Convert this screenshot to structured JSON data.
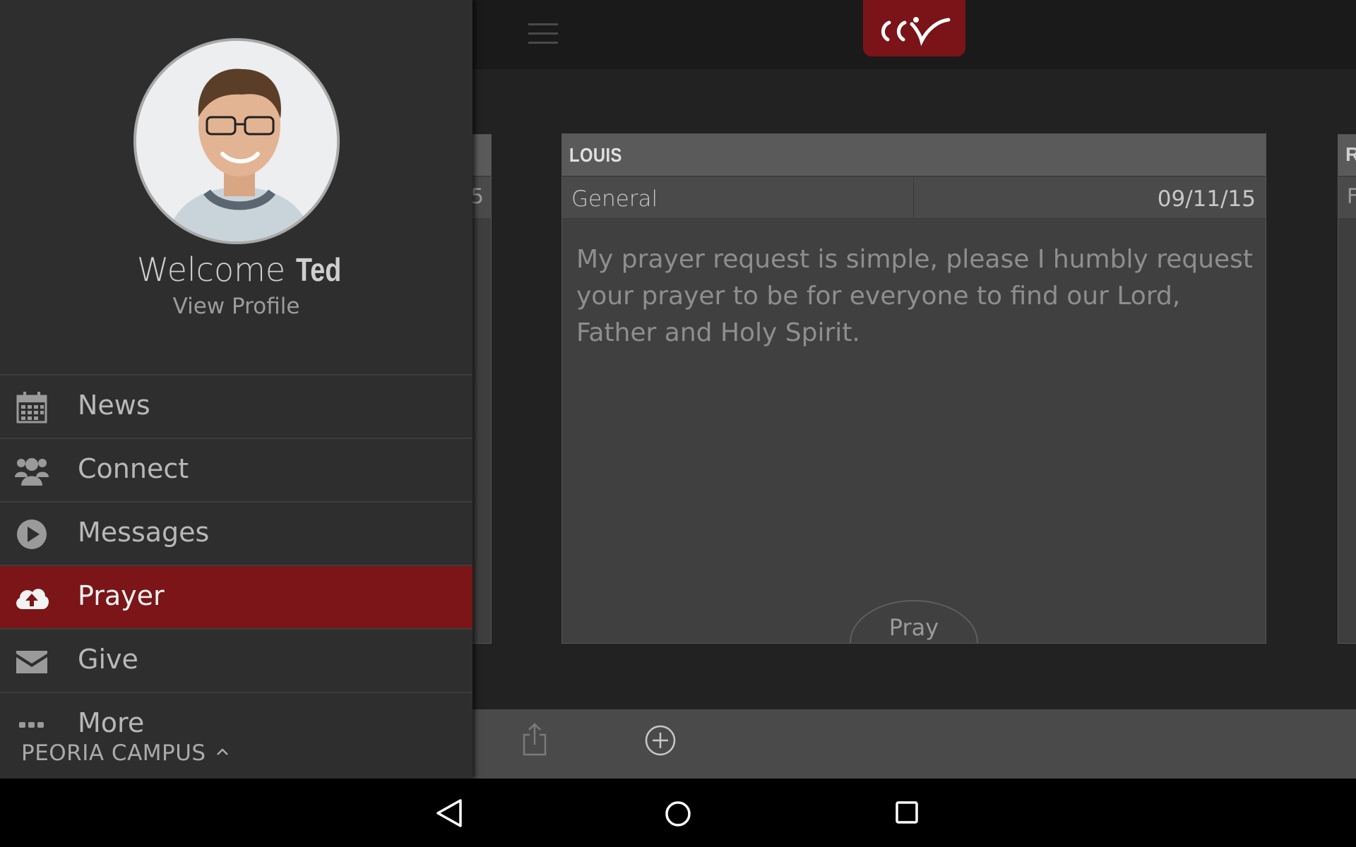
{
  "header": {
    "logo_icon": "ccv-logo"
  },
  "prayer_card": {
    "name": "LOUIS",
    "category": "General",
    "date": "09/11/15",
    "request": "My prayer request is simple, please I humbly request your prayer to be for everyone to find our Lord, Father and Holy Spirit.",
    "pray_label": "Pray"
  },
  "peek_left": {
    "date_fragment": "5"
  },
  "peek_right": {
    "title_fragment": "R",
    "category_fragment": "F"
  },
  "bottom_bar": {
    "share_icon": "share-icon",
    "add_icon": "add-circle-icon"
  },
  "drawer": {
    "welcome": "Welcome",
    "user_name": "Ted",
    "view_profile": "View Profile",
    "items": [
      {
        "label": "News",
        "icon": "calendar-icon"
      },
      {
        "label": "Connect",
        "icon": "users-icon"
      },
      {
        "label": "Messages",
        "icon": "play-circle-icon"
      },
      {
        "label": "Prayer",
        "icon": "cloud-upload-icon",
        "active": true
      },
      {
        "label": "Give",
        "icon": "envelope-icon"
      },
      {
        "label": "More",
        "icon": "ellipsis-icon"
      }
    ],
    "campus": "PEORIA CAMPUS"
  },
  "colors": {
    "accent": "#7b1518",
    "drawer_bg": "#2e2e2e",
    "card_bg": "#404040"
  }
}
